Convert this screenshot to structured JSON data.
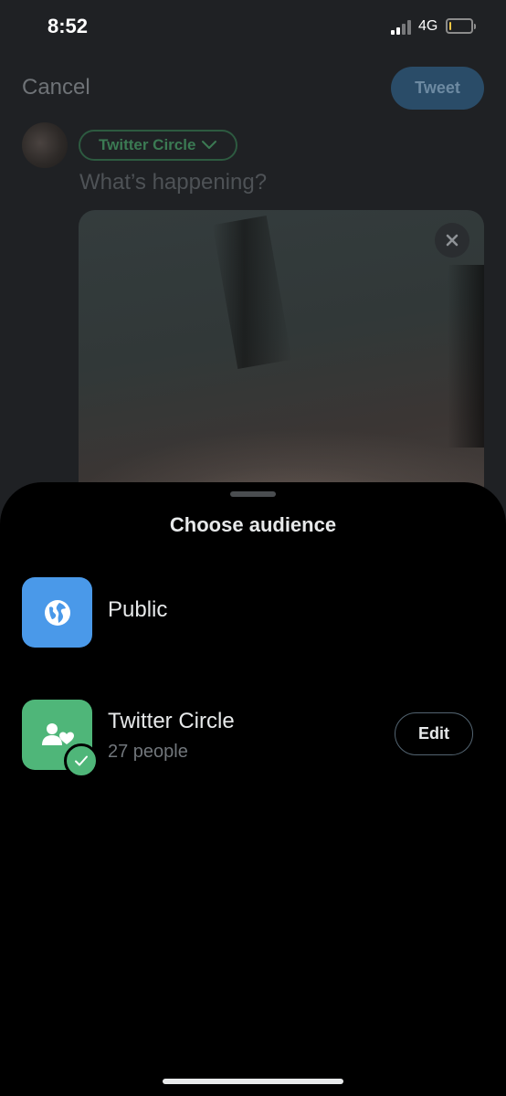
{
  "status_bar": {
    "time": "8:52",
    "network": "4G",
    "battery_level": 0.1
  },
  "compose": {
    "cancel_label": "Cancel",
    "tweet_label": "Tweet",
    "audience_label": "Twitter Circle",
    "placeholder": "What’s happening?"
  },
  "sheet": {
    "title": "Choose audience",
    "options": [
      {
        "label": "Public",
        "icon": "globe-icon",
        "color": "#4a99e9"
      },
      {
        "label": "Twitter Circle",
        "sublabel": "27 people",
        "icon": "circle-people-icon",
        "color": "#4fb679",
        "selected": true,
        "edit_label": "Edit"
      }
    ]
  },
  "colors": {
    "public_blue": "#4a99e9",
    "circle_green": "#4fb679",
    "sheet_background": "#000000"
  }
}
